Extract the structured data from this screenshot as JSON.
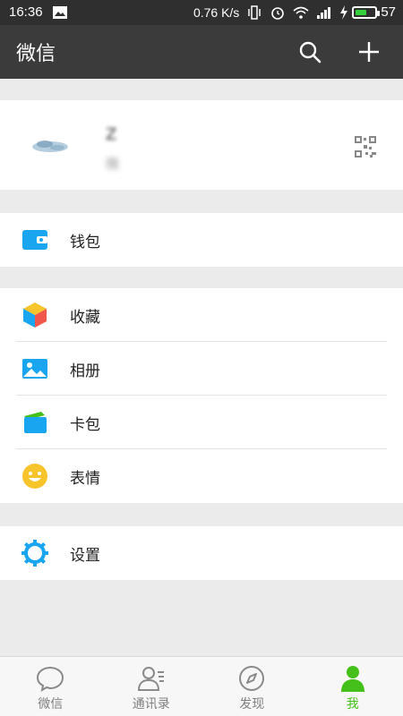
{
  "status_bar": {
    "time": "16:36",
    "network_speed": "0.76 K/s",
    "battery_level": "57",
    "battery_fraction": 0.57
  },
  "header": {
    "title": "微信",
    "search_icon": "search-icon",
    "add_icon": "plus-icon"
  },
  "profile": {
    "name": "Z",
    "wechat_id": "微",
    "qr_icon": "qr-code-icon"
  },
  "menu": {
    "wallet": {
      "label": "钱包",
      "icon": "wallet-icon"
    },
    "favorites": {
      "label": "收藏",
      "icon": "cube-icon"
    },
    "album": {
      "label": "相册",
      "icon": "picture-icon"
    },
    "cards": {
      "label": "卡包",
      "icon": "cards-icon"
    },
    "stickers": {
      "label": "表情",
      "icon": "smiley-icon"
    },
    "settings": {
      "label": "设置",
      "icon": "gear-icon"
    }
  },
  "tabs": [
    {
      "label": "微信",
      "icon": "chat-bubble-icon",
      "active": false
    },
    {
      "label": "通讯录",
      "icon": "contacts-icon",
      "active": false
    },
    {
      "label": "发现",
      "icon": "compass-icon",
      "active": false
    },
    {
      "label": "我",
      "icon": "person-icon",
      "active": true
    }
  ],
  "colors": {
    "header_bg": "#3b3b3b",
    "status_bg": "#2f2f2f",
    "accent_green": "#45c01a",
    "icon_blue": "#1aa5f0",
    "smiley_yellow": "#f7c52b"
  }
}
